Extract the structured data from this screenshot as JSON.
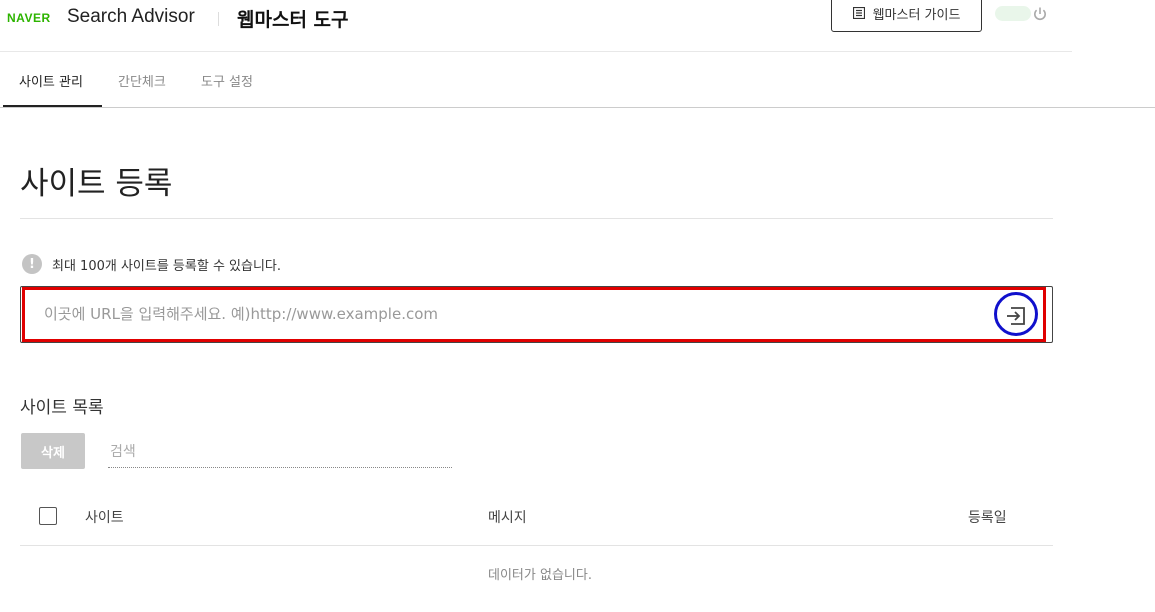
{
  "header": {
    "brand": "NAVER",
    "product": "Search Advisor",
    "tool_title": "웹마스터 도구",
    "guide_button": "웹마스터 가이드",
    "icons": {
      "guide": "book-icon",
      "power": "power-icon"
    },
    "accent_color": "#2DB400"
  },
  "tabs": [
    {
      "label": "사이트 관리",
      "active": true
    },
    {
      "label": "간단체크",
      "active": false
    },
    {
      "label": "도구 설정",
      "active": false
    }
  ],
  "main": {
    "title": "사이트 등록",
    "notice": "최대 100개 사이트를 등록할 수 있습니다.",
    "notice_icon": "!",
    "url_input": {
      "placeholder": "이곳에 URL을 입력해주세요. 예)http://www.example.com",
      "value": ""
    },
    "submit_icon": "enter-arrow-icon"
  },
  "site_list": {
    "title": "사이트 목록",
    "delete_button": "삭제",
    "search_placeholder": "검색",
    "columns": [
      "사이트",
      "메시지",
      "등록일"
    ],
    "empty_message": "데이터가 없습니다."
  },
  "annotations": {
    "highlight_box_color": "#e00000",
    "highlight_circle_color": "#1010cc"
  }
}
